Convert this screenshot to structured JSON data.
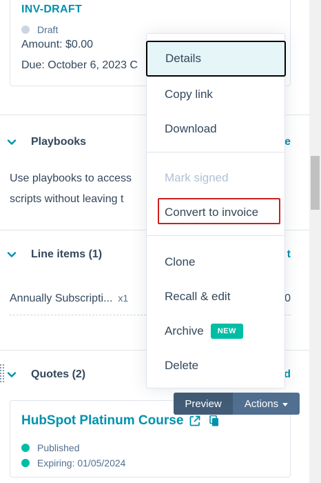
{
  "invoice": {
    "title": "INV-DRAFT",
    "status": "Draft",
    "amount": "Amount: $0.00",
    "due": "Due: October 6, 2023 C"
  },
  "playbooks": {
    "title": "Playbooks",
    "link_tail": "e",
    "text_line1": "Use playbooks to access",
    "text_line2": "scripts without leaving t"
  },
  "line_items": {
    "title": "Line items (1)",
    "link_tail": "t",
    "item_name": "Annually Subscripti...",
    "item_qty": "x1",
    "item_price_tail": "0"
  },
  "quotes": {
    "title": "Quotes (2)",
    "link_tail": "d",
    "quote_title": "HubSpot Platinum Course",
    "status_published": "Published",
    "status_expiring": "Expiring: 01/05/2024"
  },
  "buttons": {
    "preview": "Preview",
    "actions": "Actions"
  },
  "menu": {
    "details": "Details",
    "copy_link": "Copy link",
    "download": "Download",
    "mark_signed": "Mark signed",
    "convert_to_invoice": "Convert to invoice",
    "clone": "Clone",
    "recall_edit": "Recall & edit",
    "archive": "Archive",
    "archive_badge": "NEW",
    "delete": "Delete"
  },
  "colors": {
    "link": "#0091ae",
    "text": "#33475b",
    "published": "#00bda5",
    "draft": "#cbd6e2",
    "highlight_box": "#cc1e1e"
  },
  "icons": [
    "chevron-down-icon",
    "external-link-icon",
    "copy-icon",
    "drag-handle-icon",
    "caret-down-icon"
  ]
}
